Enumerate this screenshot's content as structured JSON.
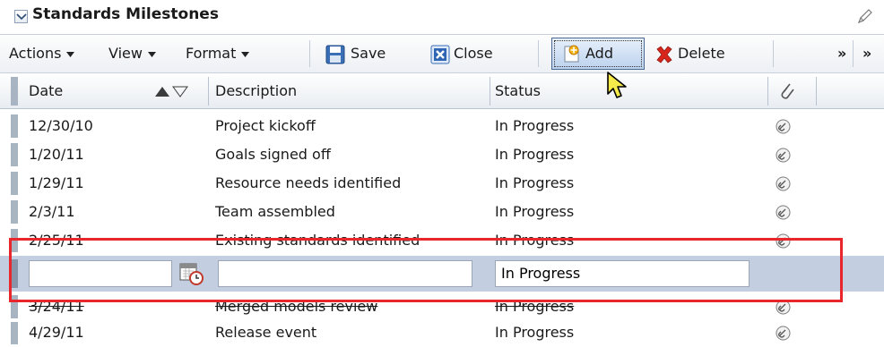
{
  "panel": {
    "title": "Standards Milestones"
  },
  "toolbar": {
    "actions_label": "Actions",
    "view_label": "View",
    "format_label": "Format",
    "save_label": "Save",
    "close_label": "Close",
    "add_label": "Add",
    "delete_label": "Delete",
    "overflow_label": "»",
    "overflow2_label": "»"
  },
  "table": {
    "columns": {
      "date": "Date",
      "description": "Description",
      "status": "Status"
    },
    "rows": [
      {
        "date": "12/30/10",
        "description": "Project kickoff",
        "status": "In Progress"
      },
      {
        "date": "1/20/11",
        "description": "Goals signed off",
        "status": "In Progress"
      },
      {
        "date": "1/29/11",
        "description": "Resource needs identified",
        "status": "In Progress"
      },
      {
        "date": "2/3/11",
        "description": "Team assembled",
        "status": "In Progress"
      },
      {
        "date": "2/25/11",
        "description": "Existing standards identified",
        "status": "In Progress"
      },
      {
        "date": "3/24/11",
        "description": "Merged models review",
        "status": "In Progress"
      },
      {
        "date": "4/29/11",
        "description": "Release event",
        "status": "In Progress"
      }
    ],
    "new_row": {
      "date": "",
      "description": "",
      "status": "In Progress"
    }
  },
  "colors": {
    "highlight": "#e8262c",
    "selected_row": "#c3cee0",
    "row_header": "#a9b4c3"
  },
  "icons": {
    "collapse": "chevron-down-icon",
    "edit": "pencil-icon",
    "save": "floppy-disk-icon",
    "close": "close-icon",
    "add": "add-star-icon",
    "delete": "red-x-icon",
    "sort": "sort-arrows-icon",
    "attachment": "paperclip-icon",
    "calendar": "calendar-clock-icon"
  }
}
